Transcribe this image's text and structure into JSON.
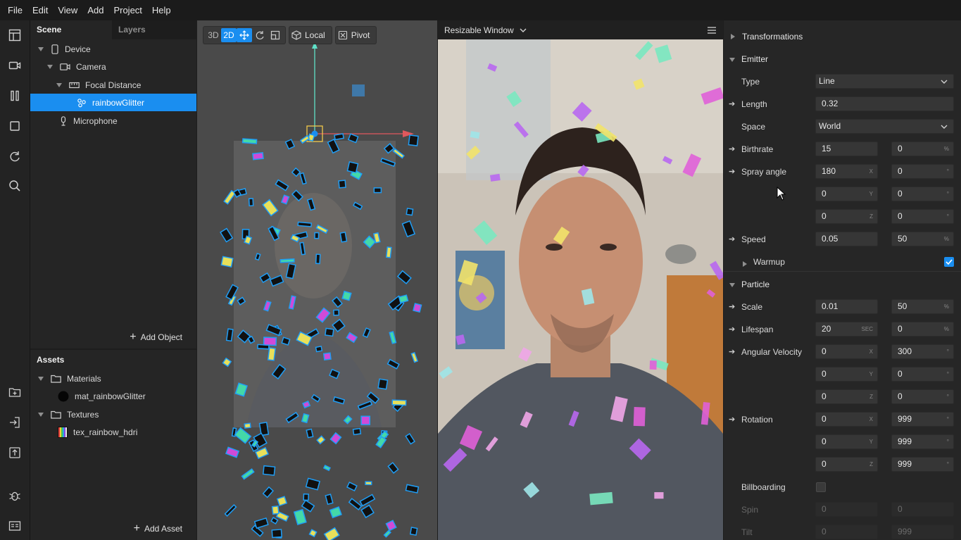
{
  "menu": [
    "File",
    "Edit",
    "View",
    "Add",
    "Project",
    "Help"
  ],
  "scene": {
    "tabs": [
      "Scene",
      "Layers"
    ],
    "items": [
      {
        "label": "Device",
        "icon": "device-icon"
      },
      {
        "label": "Camera",
        "icon": "camera-icon"
      },
      {
        "label": "Focal Distance",
        "icon": "focal-distance-icon"
      },
      {
        "label": "rainbowGlitter",
        "icon": "particle-emitter-icon"
      },
      {
        "label": "Microphone",
        "icon": "microphone-icon"
      }
    ],
    "add_object": "Add Object"
  },
  "assets": {
    "title": "Assets",
    "items": [
      {
        "label": "Materials",
        "icon": "folder-icon"
      },
      {
        "label": "mat_rainbowGlitter",
        "icon": "material-swatch-icon"
      },
      {
        "label": "Textures",
        "icon": "folder-icon"
      },
      {
        "label": "tex_rainbow_hdri",
        "icon": "texture-thumbnail-icon"
      }
    ],
    "add_asset": "Add Asset"
  },
  "viewport": {
    "mode_3d": "3D",
    "mode_2d": "2D",
    "space": "Local",
    "pivot": "Pivot"
  },
  "preview": {
    "title": "Resizable Window"
  },
  "inspector": {
    "transformations": "Transformations",
    "emitter": "Emitter",
    "type_label": "Type",
    "type_value": "Line",
    "length_label": "Length",
    "length_value": "0.32",
    "space_label": "Space",
    "space_value": "World",
    "birthrate_label": "Birthrate",
    "birthrate_value": "15",
    "birthrate_var": "0",
    "spray_label": "Spray angle",
    "spray": [
      [
        "180",
        "0"
      ],
      [
        "0",
        "0"
      ],
      [
        "0",
        "0"
      ]
    ],
    "speed_label": "Speed",
    "speed_value": "0.05",
    "speed_var": "50",
    "warmup_label": "Warmup",
    "warmup_checked": true,
    "particle": "Particle",
    "scale_label": "Scale",
    "scale_value": "0.01",
    "scale_var": "50",
    "lifespan_label": "Lifespan",
    "lifespan_value": "20",
    "lifespan_var": "0",
    "angvel_label": "Angular Velocity",
    "angvel": [
      [
        "0",
        "300"
      ],
      [
        "0",
        "0"
      ],
      [
        "0",
        "0"
      ]
    ],
    "rotation_label": "Rotation",
    "rotation": [
      [
        "0",
        "999"
      ],
      [
        "0",
        "999"
      ],
      [
        "0",
        "999"
      ]
    ],
    "billboarding_label": "Billboarding",
    "billboarding_checked": false,
    "spin_label": "Spin",
    "spin": [
      "0",
      "0"
    ],
    "tilt_label": "Tilt",
    "tilt": [
      "0",
      "999"
    ],
    "units": {
      "x": "X",
      "y": "Y",
      "z": "Z",
      "percent": "%",
      "sec": "SEC",
      "deg": "°"
    }
  },
  "colors": {
    "accent": "#1a8ef0",
    "panel": "#252525",
    "viewport": "#4a4a4a"
  }
}
